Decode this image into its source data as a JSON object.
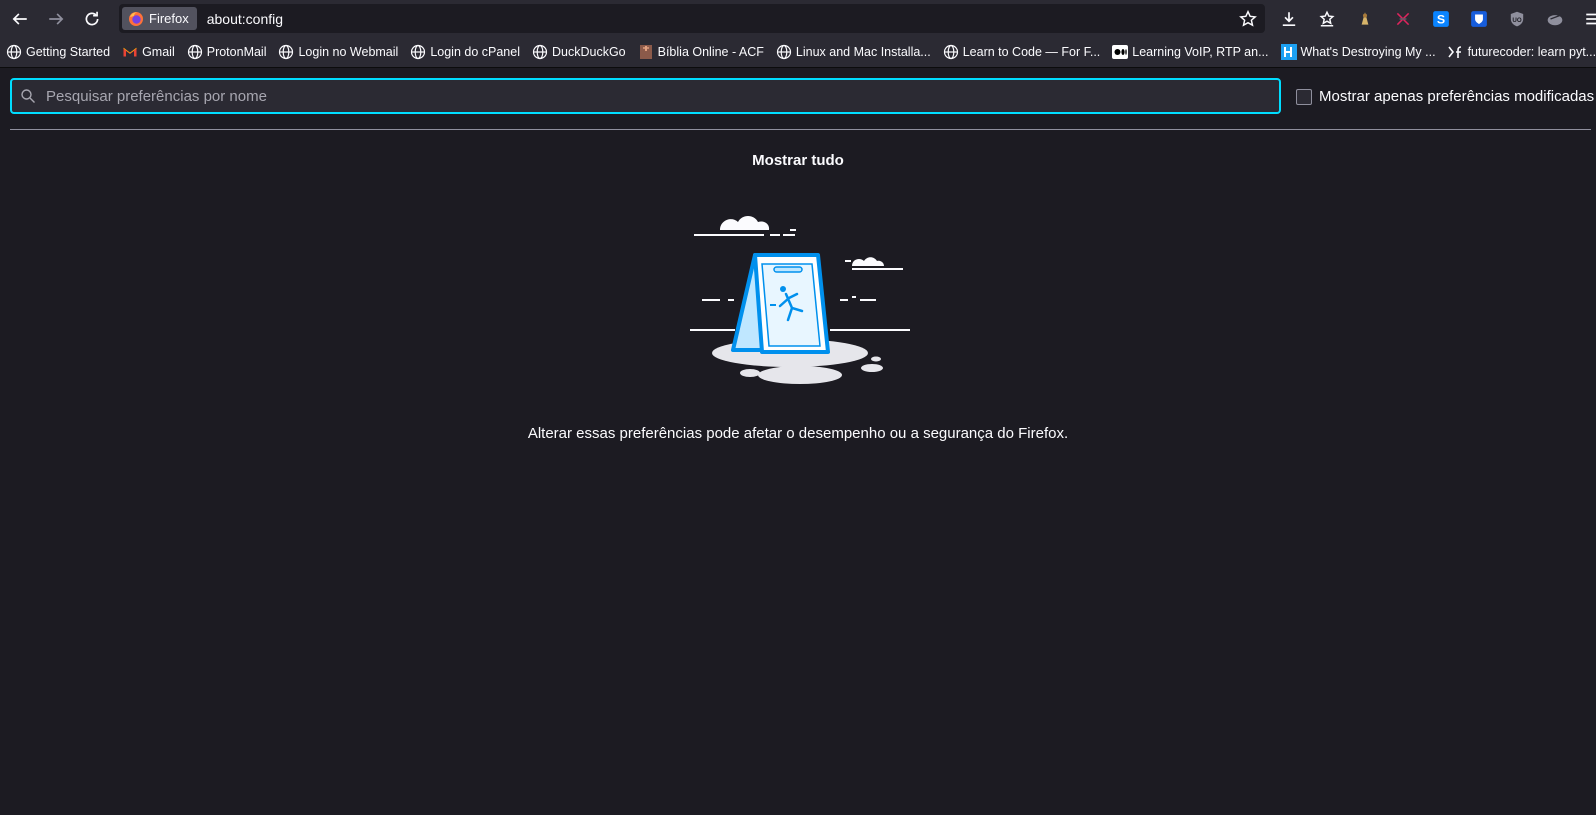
{
  "toolbar": {
    "identity_label": "Firefox",
    "url": "about:config",
    "nav_icons": [
      "back-arrow-icon",
      "forward-arrow-icon",
      "reload-icon"
    ],
    "right_icons": [
      "download-icon",
      "save-to-pocket-icon",
      "extension-icon",
      "extension-icon",
      "extension-icon",
      "bitwarden-icon",
      "shield-icon",
      "extension-icon",
      "menu-icon"
    ]
  },
  "bookmarks": [
    {
      "label": "Getting Started",
      "icon": "globe-icon"
    },
    {
      "label": "Gmail",
      "icon": "gmail-icon"
    },
    {
      "label": "ProtonMail",
      "icon": "globe-icon"
    },
    {
      "label": "Login no Webmail",
      "icon": "globe-icon"
    },
    {
      "label": "Login do cPanel",
      "icon": "globe-icon"
    },
    {
      "label": "DuckDuckGo",
      "icon": "globe-icon"
    },
    {
      "label": "Bíblia Online - ACF",
      "icon": "bible-icon"
    },
    {
      "label": "Linux and Mac Installa...",
      "icon": "globe-icon"
    },
    {
      "label": "Learn to Code — For F...",
      "icon": "globe-icon"
    },
    {
      "label": "Learning VoIP, RTP an...",
      "icon": "medium-icon"
    },
    {
      "label": "What's Destroying My ...",
      "icon": "site-icon"
    },
    {
      "label": "futurecoder: learn pyt...",
      "icon": "futurecoder-icon"
    }
  ],
  "search": {
    "placeholder": "Pesquisar preferências por nome",
    "value": ""
  },
  "modified_only_label": "Mostrar apenas preferências modificadas",
  "show_all_label": "Mostrar tudo",
  "warning_text": "Alterar essas preferências pode afetar o desempenho ou a segurança do Firefox.",
  "colors": {
    "background": "#1c1b22",
    "toolbar": "#2b2a33",
    "accent": "#00ddff",
    "illustration_blue": "#0090ed"
  }
}
